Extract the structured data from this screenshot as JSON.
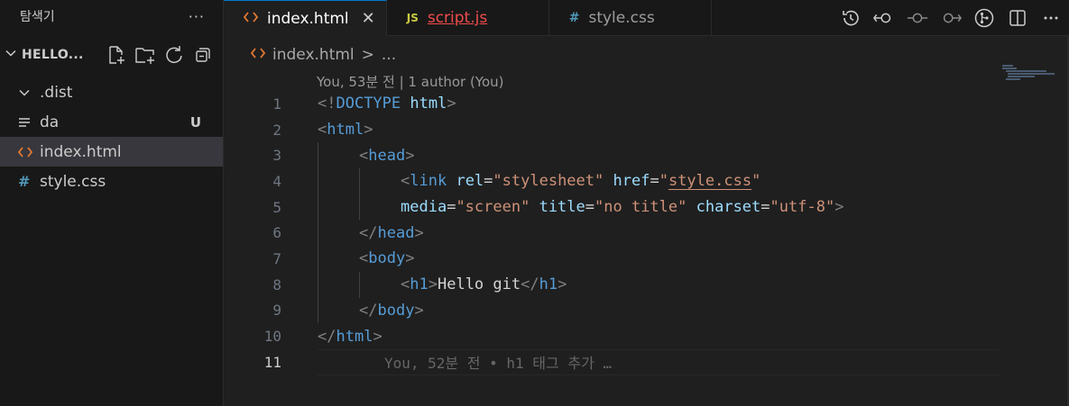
{
  "sidebar": {
    "title": "탐색기",
    "more": "···",
    "section_title": "HELLO...",
    "items": [
      {
        "label": ".dist",
        "icon": "chevron-down-icon",
        "badge": ""
      },
      {
        "label": "da",
        "icon": "lines-icon",
        "badge": "U"
      },
      {
        "label": "index.html",
        "icon": "html-icon",
        "badge": ""
      },
      {
        "label": "style.css",
        "icon": "css-hash-icon",
        "badge": ""
      }
    ]
  },
  "tabs": [
    {
      "label": "index.html",
      "icon": "<>",
      "close": "✕"
    },
    {
      "label": "script.js",
      "icon": "JS"
    },
    {
      "label": "style.css",
      "icon": "#"
    }
  ],
  "breadcrumb": {
    "file": "index.html",
    "sep": ">",
    "rest": "..."
  },
  "codelens": "You, 53분 전 | 1 author (You)",
  "editor": {
    "line_numbers": [
      "1",
      "2",
      "3",
      "4",
      "5",
      "6",
      "7",
      "8",
      "9",
      "10",
      "11"
    ],
    "ghost_text": "You, 52분 전 • h1 태그 추가 …",
    "tokens": {
      "l1": [
        "<!",
        "DOCTYPE",
        " ",
        "html",
        ">"
      ],
      "l2": [
        "<",
        "html",
        ">"
      ],
      "l3": [
        "<",
        "head",
        ">"
      ],
      "l4": [
        "<",
        "link",
        " ",
        "rel",
        "=",
        "\"stylesheet\"",
        " ",
        "href",
        "=",
        "\"",
        "style.css",
        "\""
      ],
      "l5": [
        "media",
        "=",
        "\"screen\"",
        " ",
        "title",
        "=",
        "\"no title\"",
        " ",
        "charset",
        "=",
        "\"utf-8\"",
        ">"
      ],
      "l6": [
        "</",
        "head",
        ">"
      ],
      "l7": [
        "<",
        "body",
        ">"
      ],
      "l8": [
        "<",
        "h1",
        ">",
        "Hello git",
        "</",
        "h1",
        ">"
      ],
      "l9": [
        "</",
        "body",
        ">"
      ],
      "l10": [
        "</",
        "html",
        ">"
      ]
    }
  },
  "colors": {
    "accent": "#0078d4",
    "html_icon": "#e37933",
    "css_icon": "#519aba",
    "js_icon": "#cbcb41",
    "error": "#f14c4c"
  }
}
